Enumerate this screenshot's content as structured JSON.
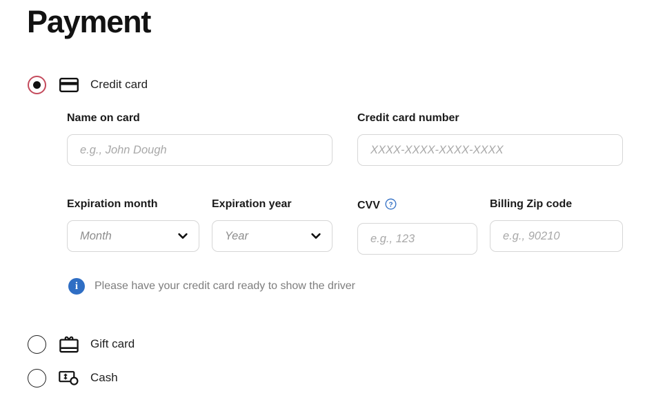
{
  "page": {
    "title": "Payment"
  },
  "payment_options": [
    {
      "id": "credit",
      "label": "Credit card",
      "icon": "credit-card-icon",
      "selected": true
    },
    {
      "id": "gift",
      "label": "Gift card",
      "icon": "gift-card-icon",
      "selected": false
    },
    {
      "id": "cash",
      "label": "Cash",
      "icon": "cash-icon",
      "selected": false
    }
  ],
  "credit_card_form": {
    "name_on_card": {
      "label": "Name on card",
      "placeholder": "e.g., John Dough",
      "value": ""
    },
    "credit_card_number": {
      "label": "Credit card number",
      "placeholder": "XXXX-XXXX-XXXX-XXXX",
      "value": ""
    },
    "expiration_month": {
      "label": "Expiration month",
      "placeholder": "Month",
      "value": ""
    },
    "expiration_year": {
      "label": "Expiration year",
      "placeholder": "Year",
      "value": ""
    },
    "cvv": {
      "label": "CVV",
      "placeholder": "e.g., 123",
      "value": "",
      "help_icon": "question-mark-circle-icon"
    },
    "billing_zip": {
      "label": "Billing Zip code",
      "placeholder": "e.g., 90210",
      "value": ""
    },
    "notice": {
      "icon": "info-icon",
      "badge_text": "i",
      "text": "Please have your credit card ready to show the driver"
    }
  },
  "colors": {
    "selected_radio_ring": "#c44a5c",
    "selected_radio_dot": "#111111",
    "unselected_radio": "#1f1f1f",
    "info_badge": "#2f6ec4",
    "help_icon": "#2f6ec4",
    "input_border": "#d6d6d6",
    "placeholder_text": "#a8a8a8",
    "label_text": "#1a1a1a",
    "notice_text": "#7d7d7d",
    "title_text": "#121212"
  }
}
